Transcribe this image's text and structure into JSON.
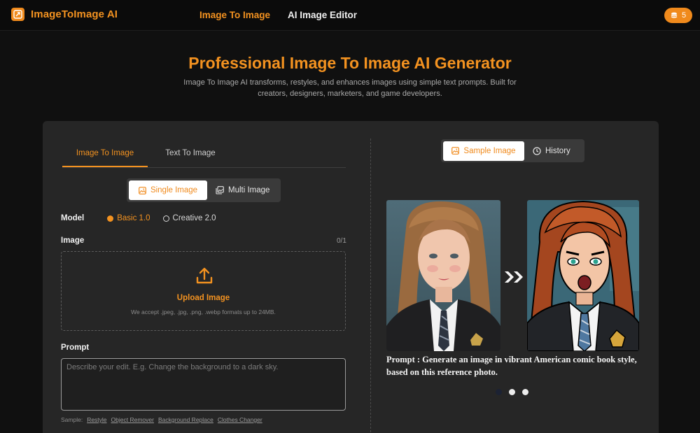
{
  "header": {
    "logo_text": "ImageToImage AI",
    "nav": [
      {
        "label": "Image To Image",
        "active": true
      },
      {
        "label": "AI Image Editor",
        "active": false
      }
    ],
    "credits": "5"
  },
  "hero": {
    "title": "Professional Image To Image AI Generator",
    "subtitle": "Image To Image AI transforms, restyles, and enhances images using simple text prompts. Built for creators, designers, marketers, and game developers."
  },
  "left": {
    "tabs": [
      {
        "label": "Image To Image",
        "active": true
      },
      {
        "label": "Text To Image",
        "active": false
      }
    ],
    "modes": [
      {
        "label": "Single Image",
        "active": true,
        "icon": "image-icon"
      },
      {
        "label": "Multi Image",
        "active": false,
        "icon": "images-icon"
      }
    ],
    "model_label": "Model",
    "models": [
      {
        "label": "Basic 1.0",
        "selected": true
      },
      {
        "label": "Creative 2.0",
        "selected": false
      }
    ],
    "image_label": "Image",
    "image_count": "0/1",
    "upload_title": "Upload Image",
    "upload_note": "We accept .jpeg, .jpg, .png, .webp formats up to 24MB.",
    "prompt_label": "Prompt",
    "prompt_placeholder": "Describe your edit. E.g. Change the background to a dark sky.",
    "sample_label": "Sample:",
    "samples": [
      "Restyle",
      "Object Remover",
      "Background Replace",
      "Clothes Changer"
    ]
  },
  "right": {
    "tabs": [
      {
        "label": "Sample Image",
        "active": true,
        "icon": "image-icon"
      },
      {
        "label": "History",
        "active": false,
        "icon": "clock-icon"
      }
    ],
    "sample_prompt": "Prompt : Generate an image in vibrant American comic book style, based on this reference photo.",
    "carousel_current": 1,
    "carousel_total": 3
  },
  "colors": {
    "accent": "#f39220",
    "background": "#101010",
    "panel": "#262626"
  }
}
